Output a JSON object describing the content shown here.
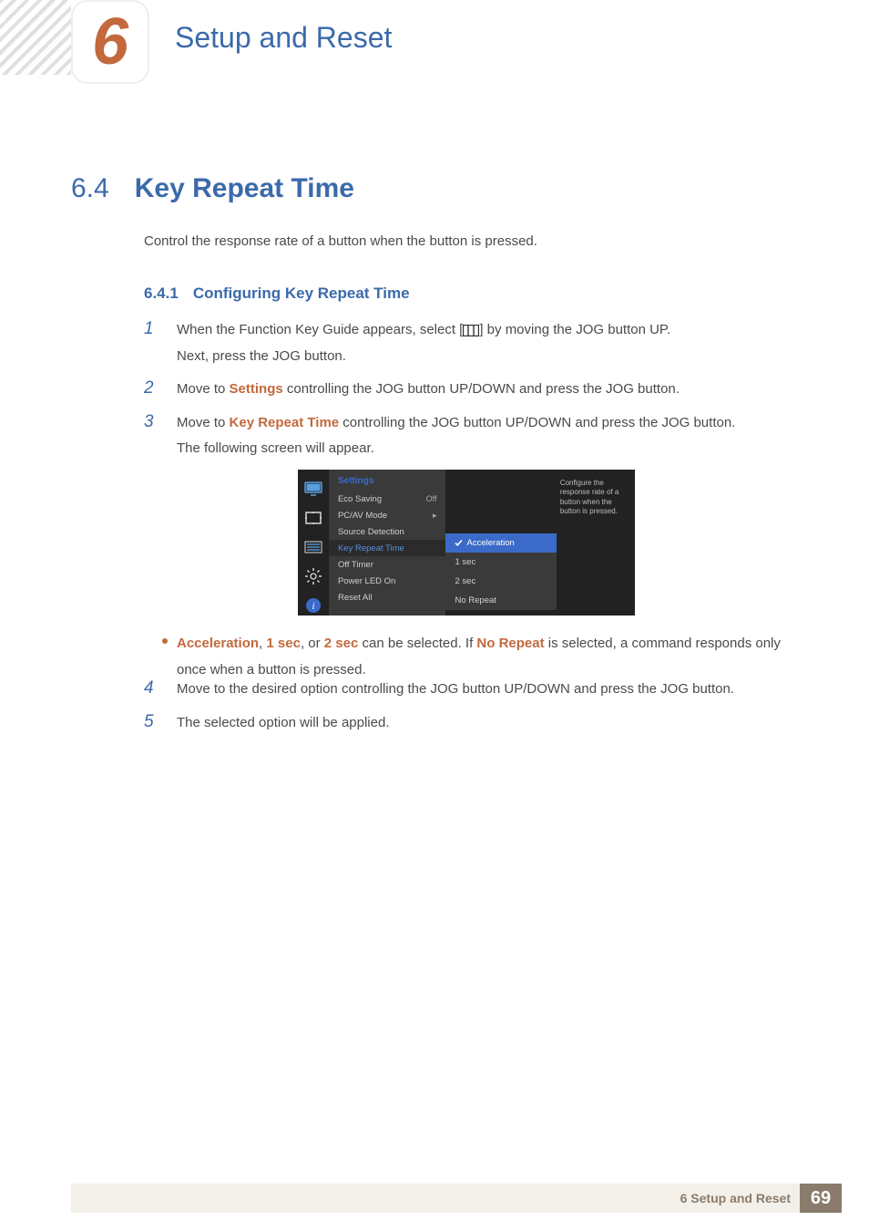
{
  "chapter": {
    "number": "6",
    "title": "Setup and Reset"
  },
  "section": {
    "number": "6.4",
    "title": "Key Repeat Time",
    "desc": "Control the response rate of a button when the button is pressed."
  },
  "sub": {
    "number": "6.4.1",
    "title": "Configuring Key Repeat Time"
  },
  "steps": {
    "s1": {
      "num": "1",
      "t1": "When the Function Key Guide appears, select [",
      "t2": "] by moving the JOG button UP.",
      "t3": "Next, press the JOG button."
    },
    "s2": {
      "num": "2",
      "t1": "Move to ",
      "kw": "Settings",
      "t2": " controlling the JOG button UP/DOWN and press the JOG button."
    },
    "s3": {
      "num": "3",
      "t1": "Move to ",
      "kw": "Key Repeat Time",
      "t2": " controlling the JOG button UP/DOWN and press the JOG button.",
      "t3": "The following screen will appear."
    },
    "s4": {
      "num": "4",
      "t": "Move to the desired option controlling the JOG button UP/DOWN and press the JOG button."
    },
    "s5": {
      "num": "5",
      "t": "The selected option will be applied."
    }
  },
  "note": {
    "kw1": "Acceleration",
    "kw2": "1 sec",
    "kw3": "2 sec",
    "kw4": "No Repeat",
    "t1": ", ",
    "t2": ", or ",
    "t3": " can be selected. If ",
    "t4": " is selected, a command responds only once when a button is pressed."
  },
  "osd": {
    "title": "Settings",
    "items": [
      {
        "label": "Eco Saving",
        "val": "Off"
      },
      {
        "label": "PC/AV Mode",
        "val": "▸"
      },
      {
        "label": "Source Detection",
        "val": ""
      },
      {
        "label": "Key Repeat Time",
        "val": ""
      },
      {
        "label": "Off Timer",
        "val": ""
      },
      {
        "label": "Power LED On",
        "val": ""
      },
      {
        "label": "Reset All",
        "val": ""
      }
    ],
    "popup": [
      "Acceleration",
      "1 sec",
      "2 sec",
      "No Repeat"
    ],
    "help": "Configure the response rate of a button when the button is pressed."
  },
  "footer": {
    "text": "6 Setup and Reset",
    "page": "69"
  }
}
